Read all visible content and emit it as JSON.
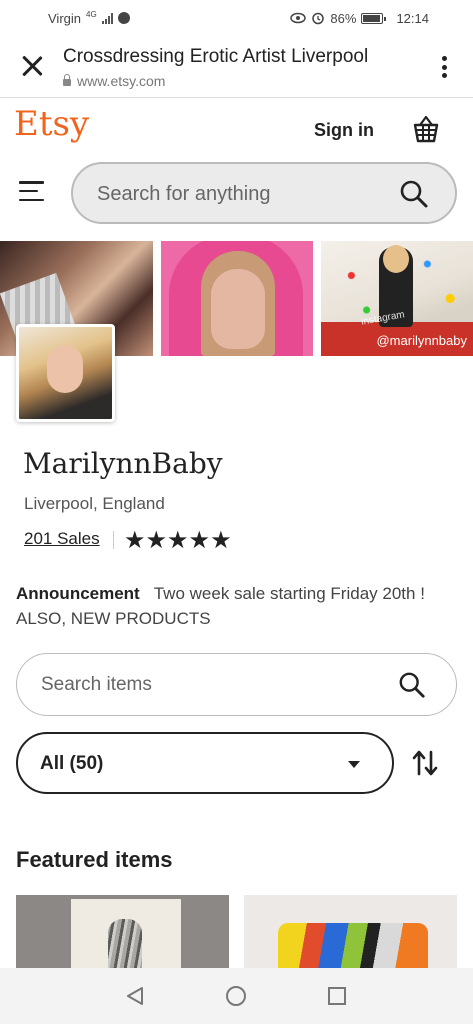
{
  "status_bar": {
    "carrier": "Virgin",
    "network": "4G",
    "battery": "86%",
    "time": "12:14"
  },
  "browser": {
    "tab_title": "Crossdressing Erotic Artist Liverpool",
    "url": "www.etsy.com"
  },
  "header": {
    "logo": "Etsy",
    "sign_in": "Sign in",
    "search_placeholder": "Search for anything",
    "brand_color": "#f1641e"
  },
  "banner": {
    "tile3_overlay": "@marilynnbaby",
    "tile3_watermark": "instagram"
  },
  "shop": {
    "name": "MarilynnBaby",
    "location": "Liverpool, England",
    "sales": "201 Sales",
    "rating": 5,
    "stars": "★★★★★",
    "announcement_label": "Announcement",
    "announcement_text": "Two week sale starting Friday 20th ! ALSO, NEW PRODUCTS"
  },
  "items": {
    "search_placeholder": "Search items",
    "filter_selected": "All (50)",
    "featured_title": "Featured items"
  },
  "icons": {
    "close": "close-icon",
    "menu": "kebab-menu-icon",
    "cart": "basket-icon",
    "hamburger": "hamburger-icon",
    "search": "search-icon",
    "sort": "sort-icon",
    "back": "back-triangle-icon",
    "home": "home-circle-icon",
    "recents": "recents-square-icon"
  }
}
